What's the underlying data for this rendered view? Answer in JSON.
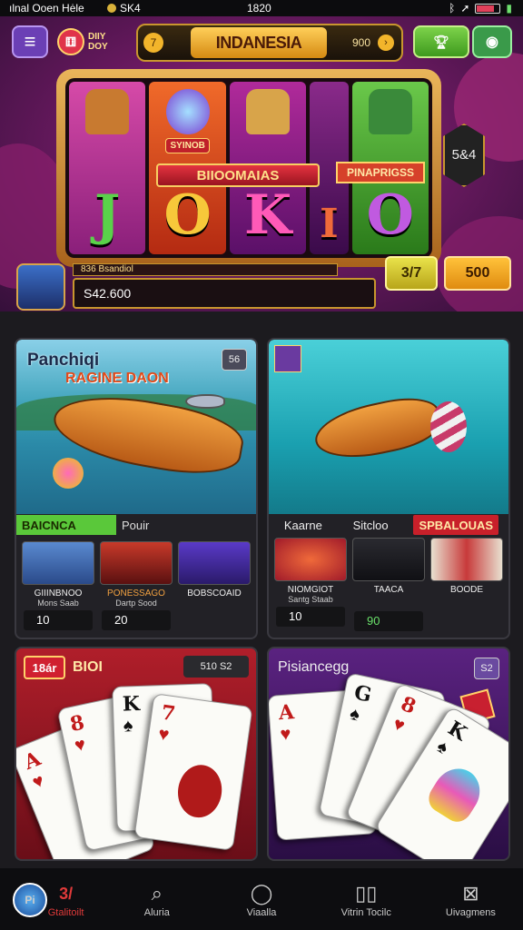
{
  "status_bar": {
    "carrier": "ılnal Ooen Hėle",
    "signal_text": "SK4",
    "time": "1820",
    "battery_fraction": 0.7
  },
  "header": {
    "menu_icon": "hamburger-menu-icon",
    "logo_text": "DIIY DOY",
    "banner_title": "INDANESIA",
    "banner_coin_label": "7",
    "banner_value": "900",
    "trophy_icon": "trophy-icon",
    "gift_icon": "gift-icon"
  },
  "slot": {
    "reel_letters": [
      "J",
      "O",
      "K",
      "I",
      "O"
    ],
    "reel_tags": [
      "",
      "SYINOB",
      "",
      "",
      ""
    ],
    "center_tag": "BIIOOMAIAS",
    "right_tag": "PINAPRIGSS",
    "hex_badge": "5&4",
    "player_name": "836 Bsandiol",
    "bet_value": "S42.600",
    "btn_spin": "3/7",
    "btn_bet": "500"
  },
  "fishing_card_1": {
    "title": "Panchiqi",
    "subtitle": "RAGINE DAON",
    "badge": "56",
    "tabs": [
      "BAICNCA",
      "Pouir"
    ],
    "items": [
      {
        "name": "GIIINBNOO",
        "sub": "Mons Saab",
        "value": "10"
      },
      {
        "name": "PONESSAGO",
        "sub": "Dartp Sood",
        "value": "20"
      },
      {
        "name": "BOBSCOAID",
        "sub": "",
        "value": ""
      }
    ]
  },
  "fishing_card_2": {
    "badge": "",
    "tabs": [
      "Kaarne",
      "Sitcloo",
      "SPBALOUAS"
    ],
    "items": [
      {
        "name": "NIOMGIOT",
        "sub": "Santg Staab",
        "value": "10"
      },
      {
        "name": "TAACA",
        "sub": "",
        "value": "90"
      },
      {
        "name": "BOODE",
        "sub": "",
        "value": ""
      }
    ]
  },
  "poker_card_1": {
    "tag": "18ár",
    "tag2": "BIOI",
    "chip": "510 S2",
    "cards": [
      {
        "rank": "A",
        "suit": "♥"
      },
      {
        "rank": "8",
        "suit": "♥"
      },
      {
        "rank": "K",
        "suit": "♠"
      },
      {
        "rank": "7",
        "suit": "♥"
      },
      {
        "rank": "A",
        "suit": "♥"
      }
    ]
  },
  "poker_card_2": {
    "title": "Pisiancegg",
    "badge": "S2",
    "cards": [
      {
        "rank": "A",
        "suit": "♥"
      },
      {
        "rank": "G",
        "suit": "♠"
      },
      {
        "rank": "8",
        "suit": "♥"
      },
      {
        "rank": "K",
        "suit": "♠"
      }
    ]
  },
  "bottom_nav": [
    {
      "label": "Gtalitoilt",
      "icon": "home-icon"
    },
    {
      "label": "Aluria",
      "icon": "search-icon"
    },
    {
      "label": "Viaalla",
      "icon": "circle-icon"
    },
    {
      "label": "Vitrin Tocilc",
      "icon": "book-icon"
    },
    {
      "label": "Uivagmens",
      "icon": "inbox-icon"
    }
  ],
  "nav_badge": "3/",
  "colors": {
    "accent_gold": "#c9962e",
    "magenta_bg": "#8a1f6c",
    "teal_water": "#2bb3c4",
    "poker_red": "#a81e2a",
    "poker_purple": "#4a1c6e"
  }
}
